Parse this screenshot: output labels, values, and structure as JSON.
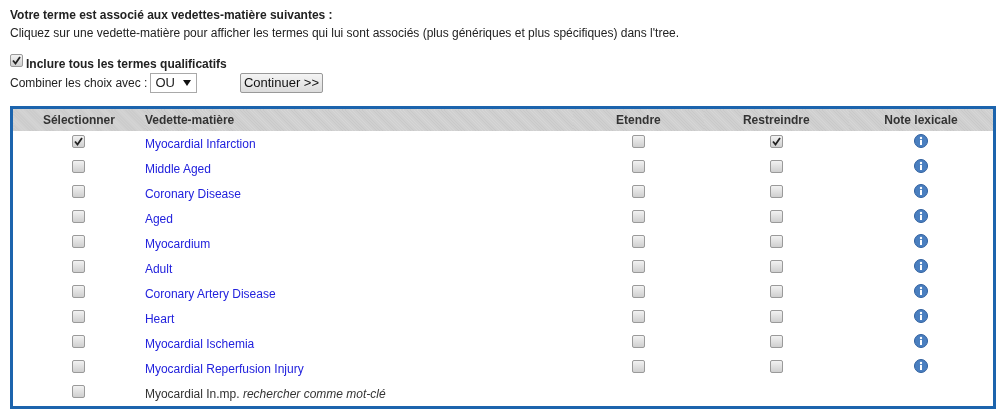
{
  "heading": "Votre terme est associé aux vedettes-matière suivantes :",
  "instructions": "Cliquez sur une vedette-matière pour afficher les termes qui lui sont associés (plus génériques et plus spécifiques) dans l'tree.",
  "include_qualifiers": {
    "label": "Inclure tous les termes qualificatifs",
    "checked": true
  },
  "combine": {
    "label": "Combiner les choix avec :",
    "value": "OU"
  },
  "continue_button": "Continuer >>",
  "table": {
    "columns": [
      "Sélectionner",
      "Vedette-matière",
      "Etendre",
      "Restreindre",
      "Note lexicale"
    ],
    "rows": [
      {
        "kind": "term",
        "term": "Myocardial Infarction",
        "selected": true,
        "extend": false,
        "restrict": true
      },
      {
        "kind": "term",
        "term": "Middle Aged",
        "selected": false,
        "extend": false,
        "restrict": false
      },
      {
        "kind": "term",
        "term": "Coronary Disease",
        "selected": false,
        "extend": false,
        "restrict": false
      },
      {
        "kind": "term",
        "term": "Aged",
        "selected": false,
        "extend": false,
        "restrict": false
      },
      {
        "kind": "term",
        "term": "Myocardium",
        "selected": false,
        "extend": false,
        "restrict": false
      },
      {
        "kind": "term",
        "term": "Adult",
        "selected": false,
        "extend": false,
        "restrict": false
      },
      {
        "kind": "term",
        "term": "Coronary Artery Disease",
        "selected": false,
        "extend": false,
        "restrict": false
      },
      {
        "kind": "term",
        "term": "Heart",
        "selected": false,
        "extend": false,
        "restrict": false
      },
      {
        "kind": "term",
        "term": "Myocardial Ischemia",
        "selected": false,
        "extend": false,
        "restrict": false
      },
      {
        "kind": "term",
        "term": "Myocardial Reperfusion Injury",
        "selected": false,
        "extend": false,
        "restrict": false
      },
      {
        "kind": "keyword",
        "term": "Myocardial In.mp. *rechercher comme mot-clé*",
        "selected": false
      }
    ]
  }
}
